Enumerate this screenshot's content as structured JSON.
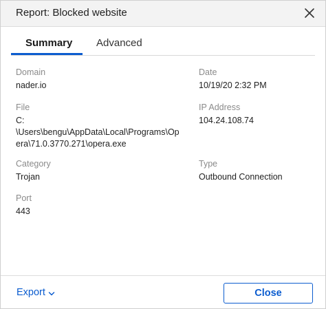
{
  "dialog": {
    "title": "Report: Blocked website"
  },
  "tabs": [
    {
      "label": "Summary",
      "active": true
    },
    {
      "label": "Advanced",
      "active": false
    }
  ],
  "fields": {
    "domain": {
      "label": "Domain",
      "value": "nader.io"
    },
    "date": {
      "label": "Date",
      "value": "10/19/20 2:32 PM"
    },
    "file": {
      "label": "File",
      "value": "C:\n\\Users\\bengu\\AppData\\Local\\Programs\\Op\nera\\71.0.3770.271\\opera.exe"
    },
    "ip": {
      "label": "IP Address",
      "value": "104.24.108.74"
    },
    "category": {
      "label": "Category",
      "value": "Trojan"
    },
    "type": {
      "label": "Type",
      "value": "Outbound Connection"
    },
    "port": {
      "label": "Port",
      "value": "443"
    }
  },
  "footer": {
    "export_label": "Export",
    "close_label": "Close"
  },
  "colors": {
    "accent": "#0b5ccf",
    "label_gray": "#8a8a8a",
    "titlebar": "#f3f3f3"
  },
  "icons": {
    "close": "close-icon",
    "export_dropdown": "chevron-down-icon"
  }
}
